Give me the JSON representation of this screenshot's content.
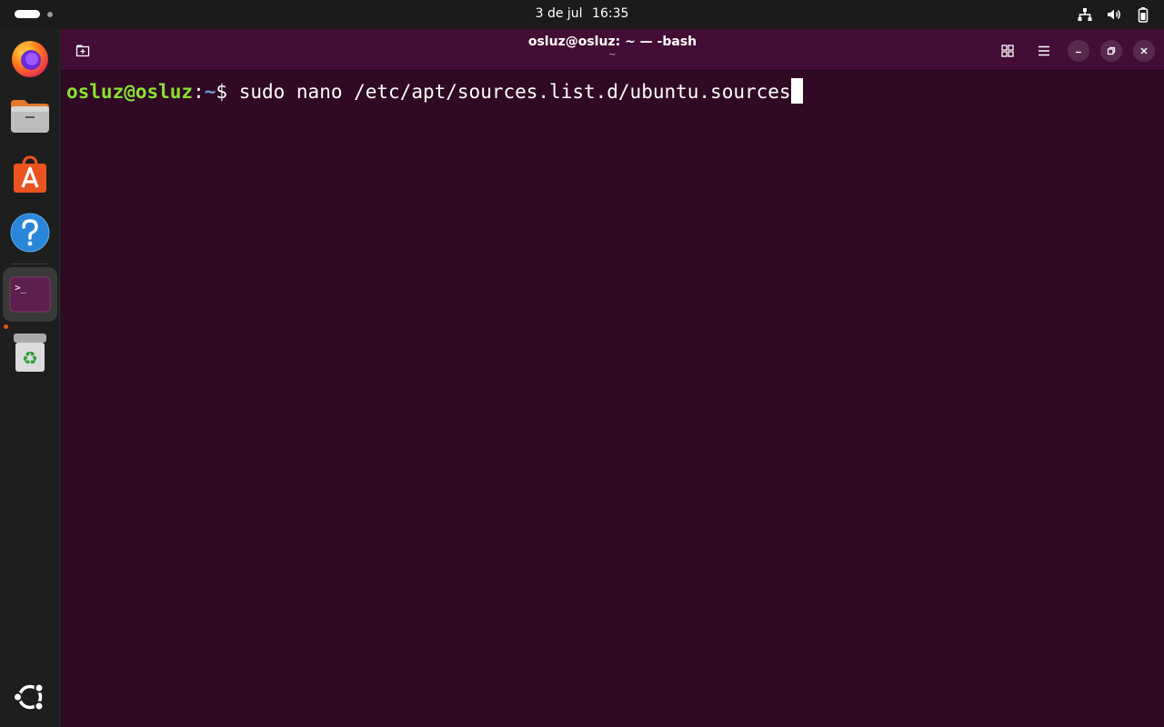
{
  "topbar": {
    "date": "3 de jul",
    "time": "16:35",
    "tray_icons": [
      "network-icon",
      "volume-icon",
      "battery-icon"
    ]
  },
  "dock": {
    "items": [
      {
        "name": "firefox",
        "icon": "firefox-icon"
      },
      {
        "name": "files",
        "icon": "files-icon"
      },
      {
        "name": "app-center",
        "icon": "app-center-icon"
      },
      {
        "name": "help",
        "icon": "help-icon"
      },
      {
        "name": "terminal",
        "icon": "terminal-icon",
        "active": true
      },
      {
        "name": "trash",
        "icon": "trash-icon"
      }
    ],
    "show_apps_icon": "ubuntu-apps-icon",
    "terminal_glyph": ">_"
  },
  "window": {
    "title": "osluz@osluz: ~ — -bash",
    "subtitle": "~"
  },
  "terminal": {
    "user_host": "osluz@osluz",
    "colon": ":",
    "path": "~",
    "prompt_symbol": "$ ",
    "command": "sudo nano /etc/apt/sources.list.d/ubuntu.sources"
  },
  "colors": {
    "terminal_bg": "#300a24",
    "headerbar_bg": "#430d35",
    "prompt_user": "#8ae234",
    "prompt_path": "#729fcf",
    "accent": "#e95420"
  }
}
